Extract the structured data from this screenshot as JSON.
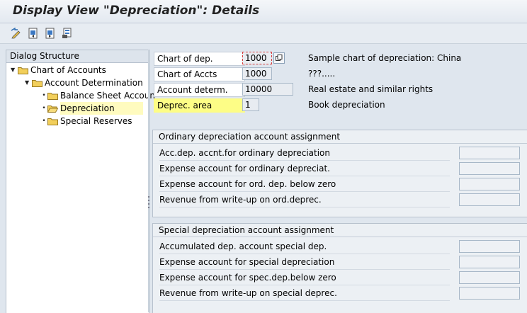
{
  "window": {
    "title": "Display View \"Depreciation\": Details"
  },
  "toolbar": {
    "buttons": [
      {
        "icon": "other-view-icon"
      },
      {
        "icon": "previous-entry-icon"
      },
      {
        "icon": "next-entry-icon"
      },
      {
        "icon": "print-icon"
      }
    ]
  },
  "dialog_structure": {
    "header": "Dialog Structure",
    "items": [
      {
        "label": "Chart of Accounts"
      },
      {
        "label": "Account Determination"
      },
      {
        "label": "Balance Sheet Accoun"
      },
      {
        "label": "Depreciation"
      },
      {
        "label": "Special Reserves"
      }
    ]
  },
  "key_fields": [
    {
      "label": "Chart of dep.",
      "value": "1000",
      "description": "Sample chart of depreciation: China"
    },
    {
      "label": "Chart of Accts",
      "value": "1000",
      "description": "???....."
    },
    {
      "label": "Account determ.",
      "value": "10000",
      "description": "Real estate and similar rights"
    },
    {
      "label": "Deprec. area",
      "value": "1",
      "description": "Book depreciation"
    }
  ],
  "ordinary": {
    "title": "Ordinary depreciation account assignment",
    "rows": [
      {
        "label": "Acc.dep. accnt.for ordinary depreciation",
        "value": ""
      },
      {
        "label": "Expense account for ordinary depreciat.",
        "value": ""
      },
      {
        "label": "Expense account for ord. dep. below zero",
        "value": ""
      },
      {
        "label": "Revenue from write-up on ord.deprec.",
        "value": ""
      }
    ]
  },
  "special": {
    "title": "Special depreciation account assignment",
    "rows": [
      {
        "label": "Accumulated dep. account special dep.",
        "value": ""
      },
      {
        "label": "Expense account for special depreciation",
        "value": ""
      },
      {
        "label": "Expense account for spec.dep.below zero",
        "value": ""
      },
      {
        "label": "Revenue from write-up on special deprec.",
        "value": ""
      }
    ]
  },
  "colors": {
    "highlight": "#fdfd86",
    "selected_row": "#fffbbf",
    "background": "#dfe6ee",
    "folder": "#f2cf5b"
  }
}
